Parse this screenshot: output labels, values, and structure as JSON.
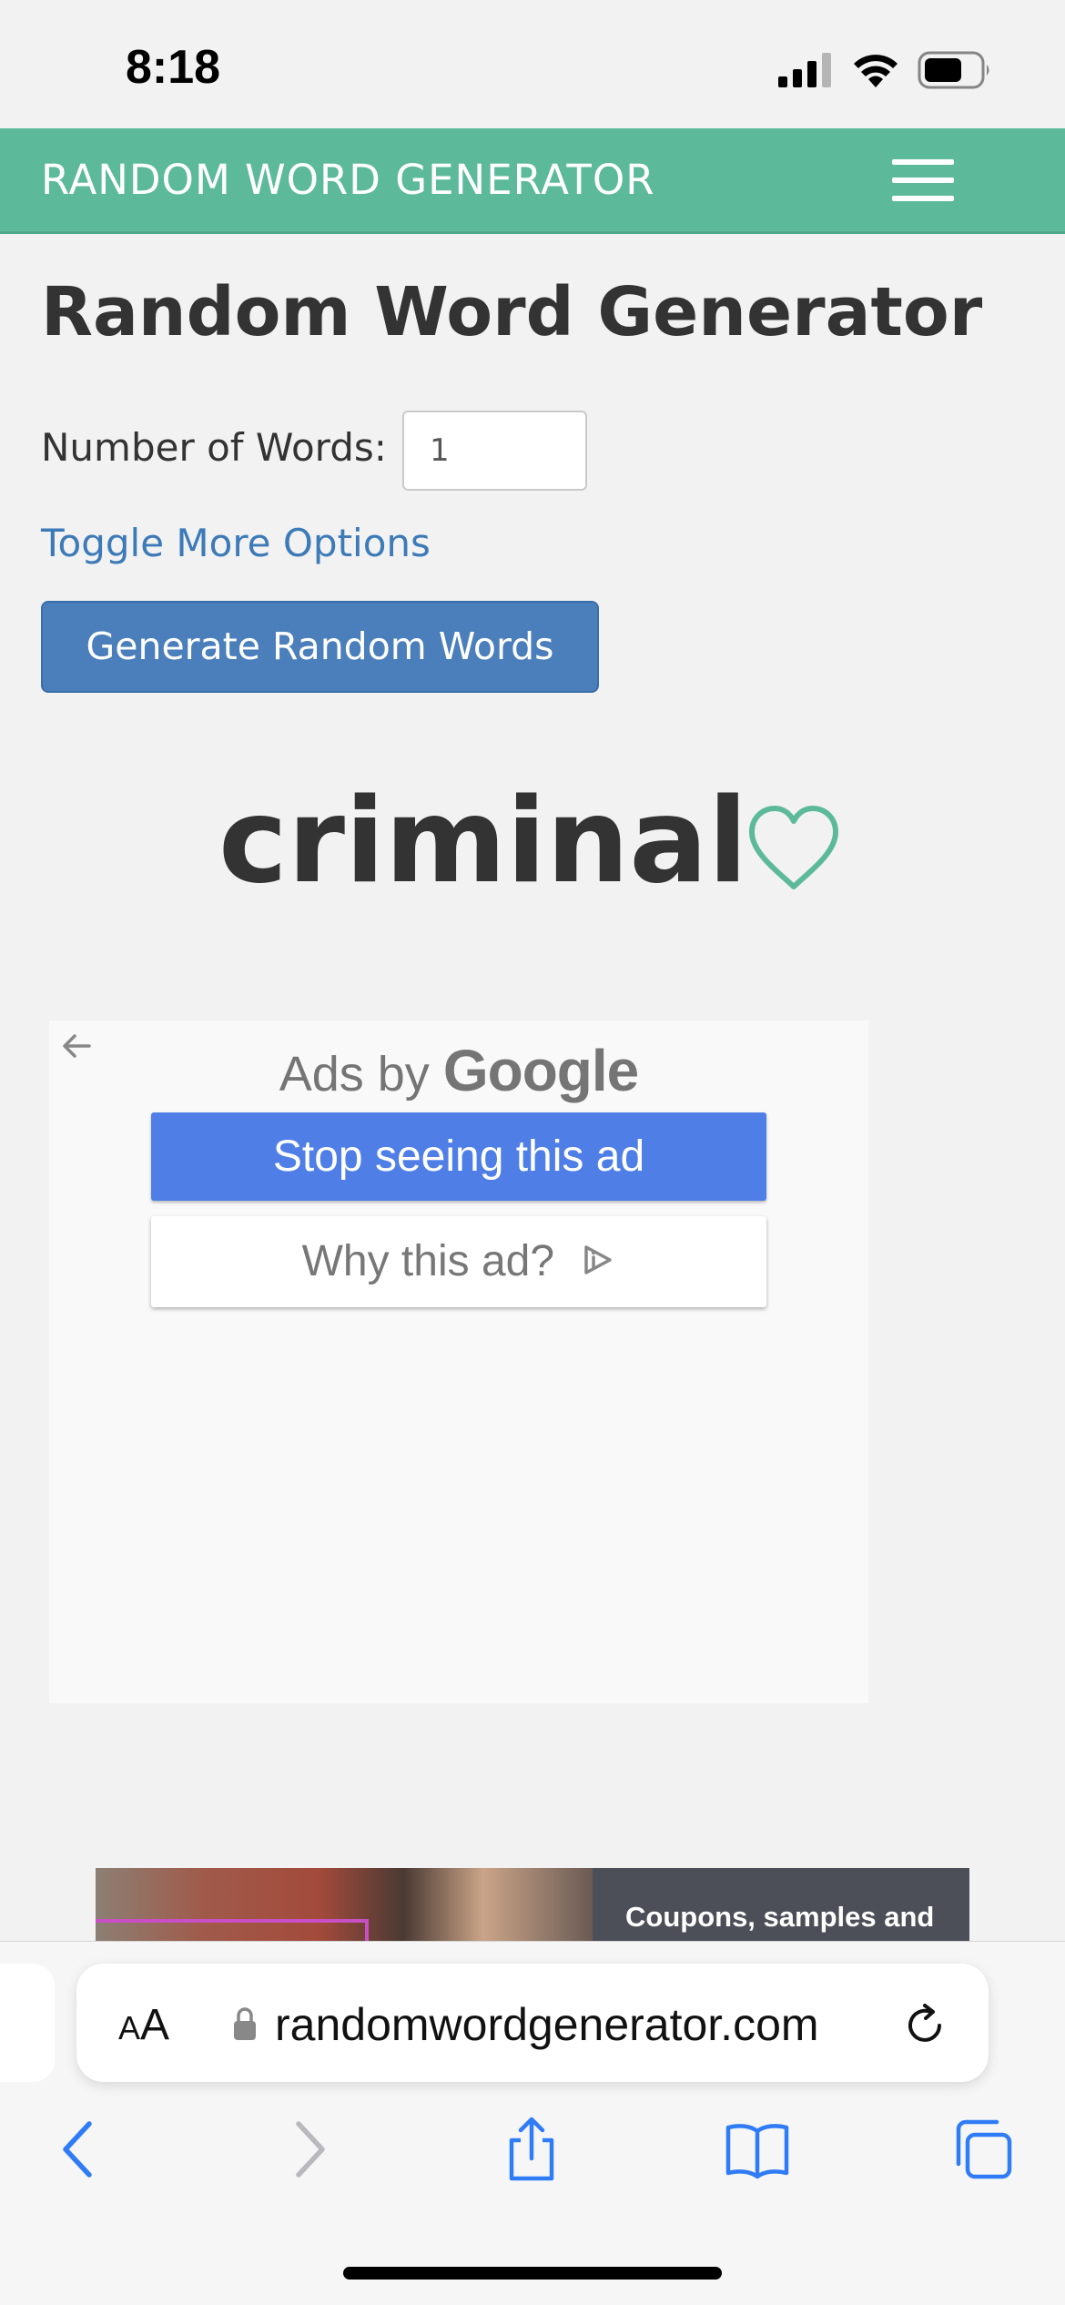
{
  "status_bar": {
    "time": "8:18"
  },
  "header": {
    "title": "RANDOM WORD GENERATOR",
    "menu_icon": "hamburger-menu-icon"
  },
  "main": {
    "title": "Random Word Generator",
    "num_words_label": "Number of Words:",
    "num_words_value": "1",
    "toggle_options_label": "Toggle More Options",
    "generate_button_label": "Generate Random Words",
    "result_word": "criminal",
    "favorite_icon": "heart-outline-icon"
  },
  "ad": {
    "ads_by": "Ads by",
    "google": "Google",
    "stop_label": "Stop seeing this ad",
    "why_label": "Why this ad?",
    "banner_text": "Coupons, samples and"
  },
  "browser": {
    "aa_small": "A",
    "aa_big": "A",
    "url": "randomwordgenerator.com",
    "icons": [
      "back-icon",
      "forward-icon",
      "share-icon",
      "bookmarks-icon",
      "tabs-icon"
    ]
  },
  "colors": {
    "header_bg": "#5cba9b",
    "link": "#3d7ab8",
    "primary_button": "#4a7fbb",
    "heart": "#5cba9b",
    "ad_stop_button": "#4f7fe6",
    "safari_tint": "#2f7cf6"
  }
}
